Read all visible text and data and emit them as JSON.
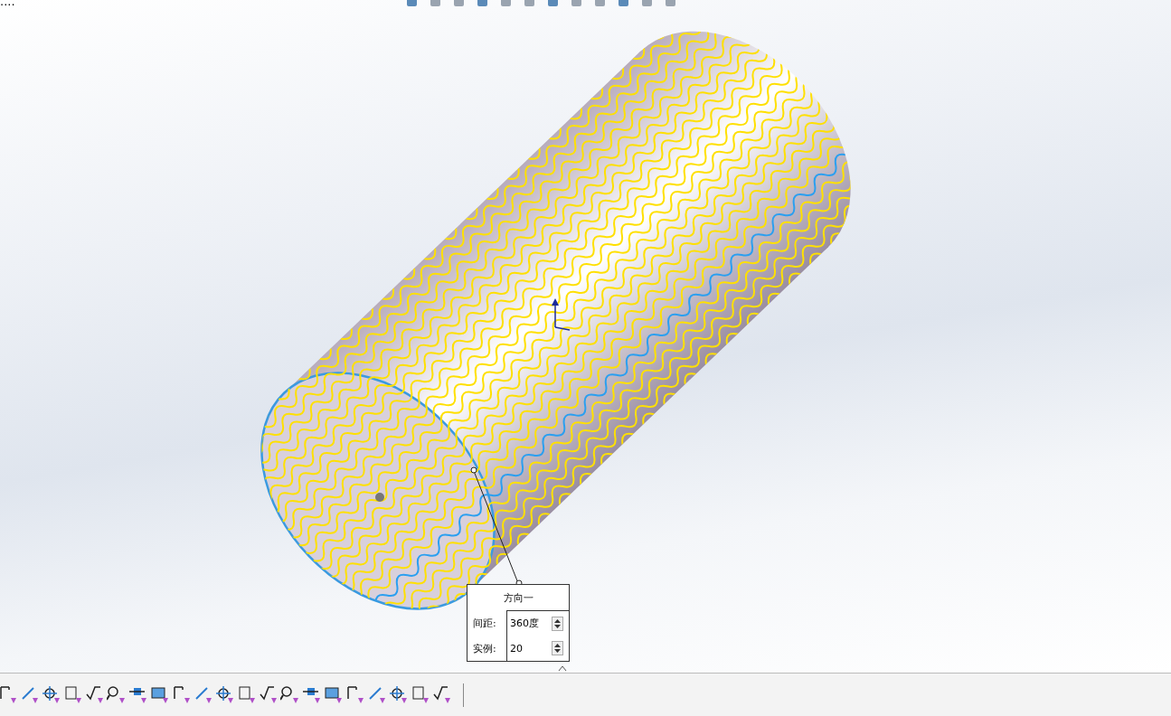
{
  "corner_text": "....",
  "callout": {
    "title": "方向一",
    "fields": [
      {
        "label": "间距:",
        "value": "360度"
      },
      {
        "label": "实例:",
        "value": "20"
      }
    ]
  }
}
